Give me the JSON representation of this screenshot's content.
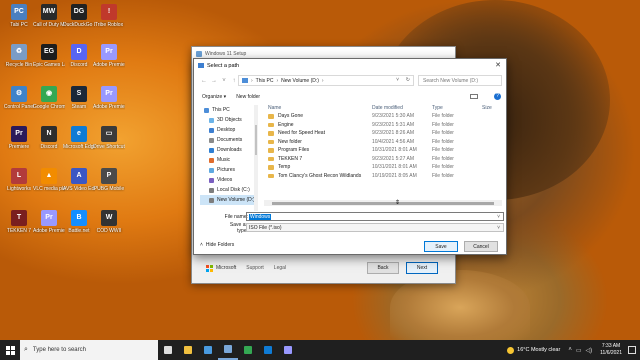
{
  "desktop": {
    "icons": [
      {
        "label": "Tabi PC",
        "color": "#4a7fc0",
        "glyph": "PC"
      },
      {
        "label": "Call of Duty Modern Wa...",
        "color": "#2a2a2a",
        "glyph": "MW"
      },
      {
        "label": "DuckDuckGo Launcher",
        "color": "#222222",
        "glyph": "DG"
      },
      {
        "label": "Tribe Roblox",
        "color": "#c0392b",
        "glyph": "!"
      },
      {
        "label": "Recycle Bin",
        "color": "#7a9cc6",
        "glyph": "♻"
      },
      {
        "label": "Epic Games Launcher",
        "color": "#1d1d1d",
        "glyph": "EG"
      },
      {
        "label": "Discord",
        "color": "#5865f2",
        "glyph": "D"
      },
      {
        "label": "Adobe Premiere Pr...",
        "color": "#9999ff",
        "glyph": "Pr"
      },
      {
        "label": "Control Panel",
        "color": "#3e83c9",
        "glyph": "⚙"
      },
      {
        "label": "Google Chrome",
        "color": "#34a853",
        "glyph": "◉"
      },
      {
        "label": "Steam",
        "color": "#1b2838",
        "glyph": "S"
      },
      {
        "label": "Adobe Premiere Pr...",
        "color": "#9999ff",
        "glyph": "Pr"
      },
      {
        "label": "Premiere",
        "color": "#2b1a5a",
        "glyph": "Pr"
      },
      {
        "label": "Discord",
        "color": "#2d2d2d",
        "glyph": "N"
      },
      {
        "label": "Microsoft Edge",
        "color": "#0f7bd5",
        "glyph": "e"
      },
      {
        "label": "Drive Shortcut",
        "color": "#3a3a3a",
        "glyph": "▭"
      },
      {
        "label": "Lightworks",
        "color": "#b23b3b",
        "glyph": "L"
      },
      {
        "label": "VLC media player",
        "color": "#f28c00",
        "glyph": "▲"
      },
      {
        "label": "AVS Video Editor",
        "color": "#3b57c4",
        "glyph": "A"
      },
      {
        "label": "PUBG Mobile",
        "color": "#4a4a4a",
        "glyph": "P"
      },
      {
        "label": "TEKKEN 7",
        "color": "#7a1f1f",
        "glyph": "T"
      },
      {
        "label": "Adobe Premiere Pr...",
        "color": "#9999ff",
        "glyph": "Pr"
      },
      {
        "label": "Battle.net",
        "color": "#148eff",
        "glyph": "B"
      },
      {
        "label": "COD WWII",
        "color": "#333333",
        "glyph": "W"
      }
    ]
  },
  "setup_window": {
    "title": "Windows 11 Setup",
    "footer": {
      "brand": "Microsoft",
      "links": [
        "Support",
        "Legal"
      ],
      "back": "Back",
      "next": "Next"
    }
  },
  "dialog": {
    "title": "Select a path",
    "close_glyph": "✕",
    "address": {
      "crumbs": [
        "This PC",
        "New Volume (D:)"
      ],
      "separator": "›"
    },
    "search_placeholder": "Search New Volume (D:)",
    "toolbar": {
      "organize": "Organize ▾",
      "new_folder": "New folder",
      "help": "?"
    },
    "nav_items": [
      {
        "label": "This PC",
        "color": "#4d8ed8",
        "selected": false
      },
      {
        "label": "3D Objects",
        "color": "#6bb3e8",
        "selected": false
      },
      {
        "label": "Desktop",
        "color": "#3d7fd0",
        "selected": false
      },
      {
        "label": "Documents",
        "color": "#8a8a8a",
        "selected": false
      },
      {
        "label": "Downloads",
        "color": "#2f7fd3",
        "selected": false
      },
      {
        "label": "Music",
        "color": "#e06c2c",
        "selected": false
      },
      {
        "label": "Pictures",
        "color": "#5ea8e0",
        "selected": false
      },
      {
        "label": "Videos",
        "color": "#7a5fc0",
        "selected": false
      },
      {
        "label": "Local Disk (C:)",
        "color": "#7d7d7d",
        "selected": false
      },
      {
        "label": "New Volume (D:)",
        "color": "#7d7d7d",
        "selected": true
      }
    ],
    "columns": {
      "name": "Name",
      "date": "Date modified",
      "type": "Type",
      "size": "Size"
    },
    "files": [
      {
        "name": "Days Gone",
        "date": "9/23/2021 5:30 AM",
        "type": "File folder"
      },
      {
        "name": "Engine",
        "date": "9/23/2021 5:31 AM",
        "type": "File folder"
      },
      {
        "name": "Need for Speed Heat",
        "date": "9/23/2021 8:26 AM",
        "type": "File folder"
      },
      {
        "name": "New folder",
        "date": "10/4/2021 4:56 AM",
        "type": "File folder"
      },
      {
        "name": "Program Files",
        "date": "10/31/2021 8:01 AM",
        "type": "File folder"
      },
      {
        "name": "TEKKEN 7",
        "date": "9/23/2021 5:27 AM",
        "type": "File folder"
      },
      {
        "name": "Temp",
        "date": "10/31/2021 8:01 AM",
        "type": "File folder"
      },
      {
        "name": "Tom Clancy's Ghost Recon Wildlands",
        "date": "10/19/2021 8:05 AM",
        "type": "File folder"
      }
    ],
    "file_name_label": "File name:",
    "file_name_value": "Windows",
    "save_as_label": "Save as type:",
    "save_as_value": "ISO File (*.iso)",
    "hide_folders": "Hide Folders",
    "save": "Save",
    "cancel": "Cancel"
  },
  "taskbar": {
    "search_placeholder": "Type here to search",
    "apps": [
      {
        "name": "task-view",
        "color": "#dddddd"
      },
      {
        "name": "file-explorer",
        "color": "#f0c040"
      },
      {
        "name": "store",
        "color": "#4a9be0"
      },
      {
        "name": "setup",
        "color": "#7aa7d9"
      },
      {
        "name": "chrome",
        "color": "#34a853"
      },
      {
        "name": "edge",
        "color": "#0f7bd5"
      },
      {
        "name": "premiere",
        "color": "#9999ff"
      }
    ],
    "weather": "16°C  Mostly clear",
    "time": "7:33 AM",
    "date": "11/6/2021"
  }
}
